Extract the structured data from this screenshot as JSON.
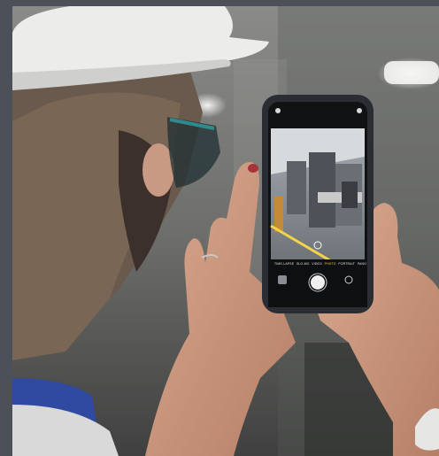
{
  "image": {
    "subject": "photo",
    "camera_modes": [
      "TIME-LAPSE",
      "SLO-MO",
      "VIDEO",
      "PHOTO",
      "PORTRAIT",
      "PANO"
    ],
    "selected_mode": "PHOTO",
    "accent_color": "#f2d34a"
  }
}
